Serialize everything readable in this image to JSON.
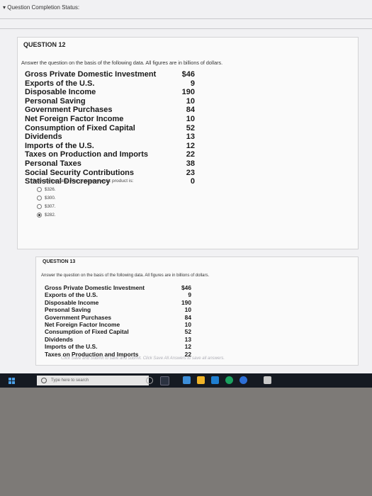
{
  "status_bar": {
    "label": "Question Completion Status:"
  },
  "q12": {
    "title": "QUESTION 12",
    "intro": "Answer the question on the basis of the following data. All figures are in billions of dollars.",
    "rows": [
      {
        "label": "Gross Private Domestic Investment",
        "value": "$46"
      },
      {
        "label": "Exports of the U.S.",
        "value": "9"
      },
      {
        "label": "Disposable Income",
        "value": "190"
      },
      {
        "label": "Personal Saving",
        "value": "10"
      },
      {
        "label": "Government Purchases",
        "value": "84"
      },
      {
        "label": "Net Foreign Factor Income",
        "value": "10"
      },
      {
        "label": "Consumption of Fixed Capital",
        "value": "52"
      },
      {
        "label": "Dividends",
        "value": "13"
      },
      {
        "label": "Imports of the U.S.",
        "value": "12"
      },
      {
        "label": "Taxes on Production and Imports",
        "value": "22"
      },
      {
        "label": "Personal Taxes",
        "value": "38"
      },
      {
        "label": "Social Security Contributions",
        "value": "23"
      },
      {
        "label": "Statistical Discrepancy",
        "value": "0"
      }
    ],
    "prompt": "Refer to the data. The gross domestic product is:",
    "options": [
      {
        "label": "$326.",
        "selected": false
      },
      {
        "label": "$300.",
        "selected": false
      },
      {
        "label": "$307.",
        "selected": false
      },
      {
        "label": "$282.",
        "selected": true
      }
    ]
  },
  "q13": {
    "title": "QUESTION 13",
    "intro": "Answer the question on the basis of the following data. All figures are in billions of dollars.",
    "rows": [
      {
        "label": "Gross Private Domestic Investment",
        "value": "$46"
      },
      {
        "label": "Exports of the U.S.",
        "value": "9"
      },
      {
        "label": "Disposable Income",
        "value": "190"
      },
      {
        "label": "Personal Saving",
        "value": "10"
      },
      {
        "label": "Government Purchases",
        "value": "84"
      },
      {
        "label": "Net Foreign Factor Income",
        "value": "10"
      },
      {
        "label": "Consumption of Fixed Capital",
        "value": "52"
      },
      {
        "label": "Dividends",
        "value": "13"
      },
      {
        "label": "Imports of the U.S.",
        "value": "12"
      },
      {
        "label": "Taxes on Production and Imports",
        "value": "22"
      }
    ]
  },
  "footer_note": "Click Save and Submit to save and submit. Click Save All Answers to save all answers.",
  "taskbar": {
    "search_placeholder": "Type here to search",
    "accent": "#4aa0e8"
  }
}
